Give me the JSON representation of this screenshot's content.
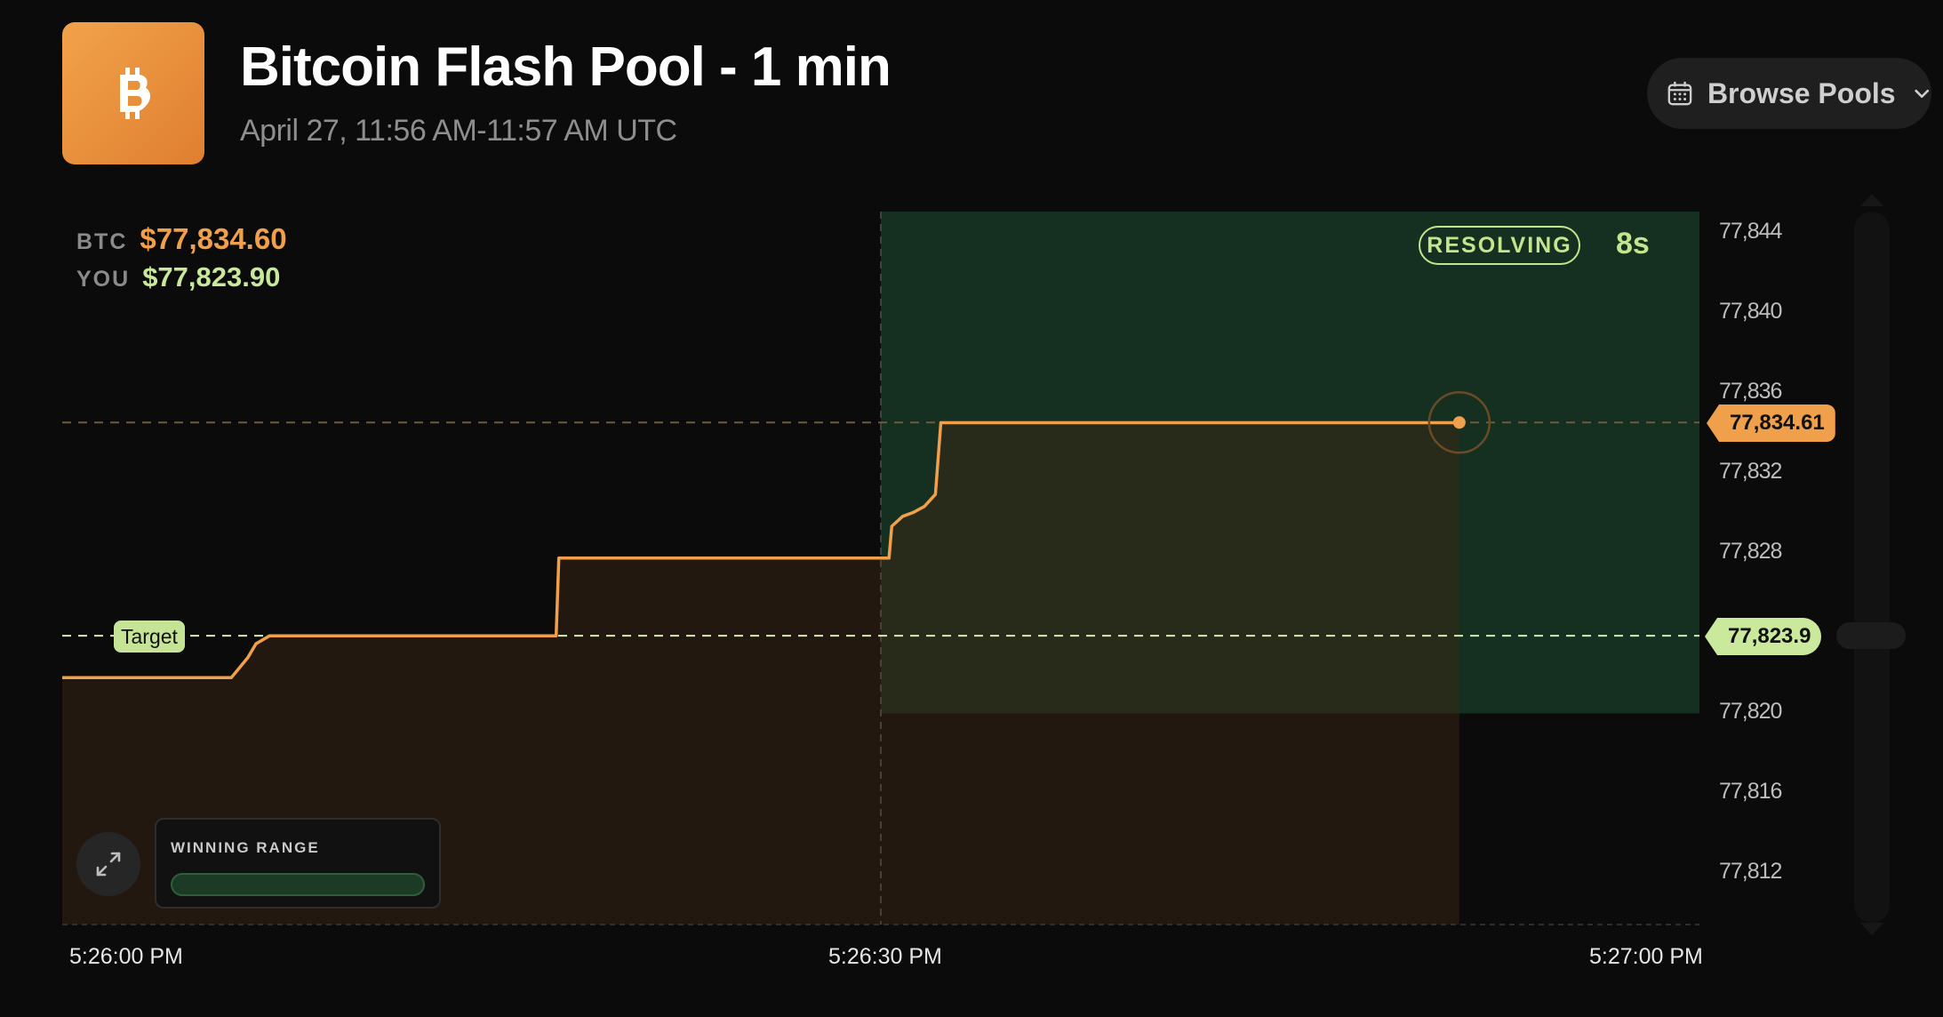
{
  "header": {
    "title": "Bitcoin Flash Pool - 1 min",
    "subtitle": "April 27, 11:56 AM-11:57 AM UTC",
    "logo_icon": "bitcoin-icon",
    "browse_label": "Browse Pools",
    "browse_icon": "calendar-icon"
  },
  "readouts": {
    "btc_symbol": "BTC",
    "btc_value": "$77,834.60",
    "you_symbol": "YOU",
    "you_value": "$77,823.90"
  },
  "status": {
    "badge": "RESOLVING",
    "countdown": "8s"
  },
  "labels": {
    "target": "Target",
    "winning_range": "WINNING RANGE"
  },
  "colors": {
    "background": "#0b0b0b",
    "btc_orange": "#f0a04a",
    "target_green": "#c6e495",
    "resolve_zone": "#173424"
  },
  "chart_data": {
    "type": "line",
    "x_ticks": [
      "5:26:00 PM",
      "5:26:30 PM",
      "5:27:00 PM"
    ],
    "y_ticks": [
      "77,844",
      "77,840",
      "77,836",
      "77,832",
      "77,828",
      "77,820",
      "77,816",
      "77,812"
    ],
    "xlim_seconds": [
      0,
      60
    ],
    "ylim": [
      77809.4,
      77845.2
    ],
    "current_price": 77834.61,
    "current_price_label": "77,834.61",
    "target_price": 77823.9,
    "target_label": "77,823.9",
    "resolve_start_seconds": 30,
    "winning_range": [
      77820,
      77845.2
    ],
    "series": [
      {
        "x": [
          0,
          6.2,
          6.8,
          7.1,
          7.6,
          18.1,
          18.2,
          30.3,
          30.4,
          30.8,
          31.2,
          31.6,
          32.0,
          32.2,
          32.4,
          60
        ],
        "y": [
          77821.8,
          77821.8,
          77822.8,
          77823.5,
          77823.9,
          77823.9,
          77827.8,
          77827.8,
          77829.4,
          77829.9,
          77830.1,
          77830.4,
          77831.0,
          77834.6,
          77834.6,
          77834.6
        ]
      }
    ],
    "series_end_seconds": 51.2,
    "grid": false
  }
}
